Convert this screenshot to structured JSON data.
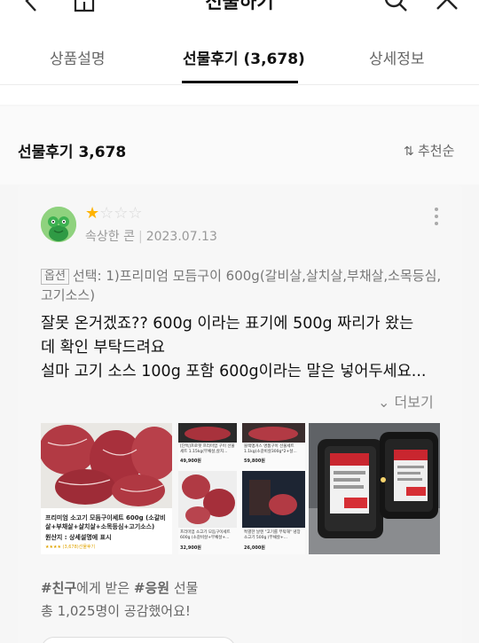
{
  "header": {
    "title": "선물하기",
    "icons": [
      "back-icon",
      "home-icon",
      "search-icon",
      "close-icon"
    ]
  },
  "tabs": [
    {
      "label": "상품설명",
      "active": false
    },
    {
      "label": "선물후기 (3,678)",
      "active": true
    },
    {
      "label": "상세정보",
      "active": false
    }
  ],
  "reviews_section": {
    "title": "선물후기 3,678",
    "sort_label": "추천순"
  },
  "review": {
    "rating": 1,
    "max_rating": 5,
    "reviewer": "속상한 콘",
    "date": "2023.07.13",
    "option_badge": "옵션",
    "option_text": "선택: 1)프리미엄 모듬구이 600g(갈비살,살치살,부채살,소목등심,고기소스)",
    "text_lines": [
      "잘못 온거겠죠?? 600g 이라는 표기에 500g 짜리가 왔는",
      "데 확인 부탁드려요",
      "설마 고기 소스 100g 포함 600g이라는 말은 넣어두세요..."
    ],
    "see_more_label": "더보기",
    "photo1": {
      "title": "프리미엄 소고기 모듬구이세트 600g (소갈비살+부채살+살치살+소목등심+고기소스)",
      "origin": "원산지 : 상세설명에 표시",
      "footer": "★★★★ (3,678)선물후기"
    },
    "photo2": {
      "items": [
        {
          "name": "[단독]프로핏 프리미엄 구이 선물세트 1.15kg(부채살,살치...",
          "price": "49,900원"
        },
        {
          "name": "블랙앵거스 명품구이 선물세트 1.1kg(소갈비살300g*2+살...",
          "price": "59,800원"
        },
        {
          "name": "프리미엄 소고기 모듬구이세트 600g (소갈비살+부채살+...",
          "price": "32,900원"
        },
        {
          "name": "특별한 날엔 \"고기를 부탁해\" 냉장 소고기 500g (부채살+...",
          "price": "26,000원"
        }
      ]
    },
    "gift_line": {
      "friend_tag": "#친구",
      "middle": "에게 받은 ",
      "cheer_tag": "#응원",
      "suffix": " 선물"
    },
    "empathy_text": "총 1,025명이 공감했어요!"
  },
  "colors": {
    "star_filled": "#ffb300",
    "star_empty": "#d8d8d8",
    "active_tab": "#111111",
    "avatar_bg": "#8fd27e"
  }
}
